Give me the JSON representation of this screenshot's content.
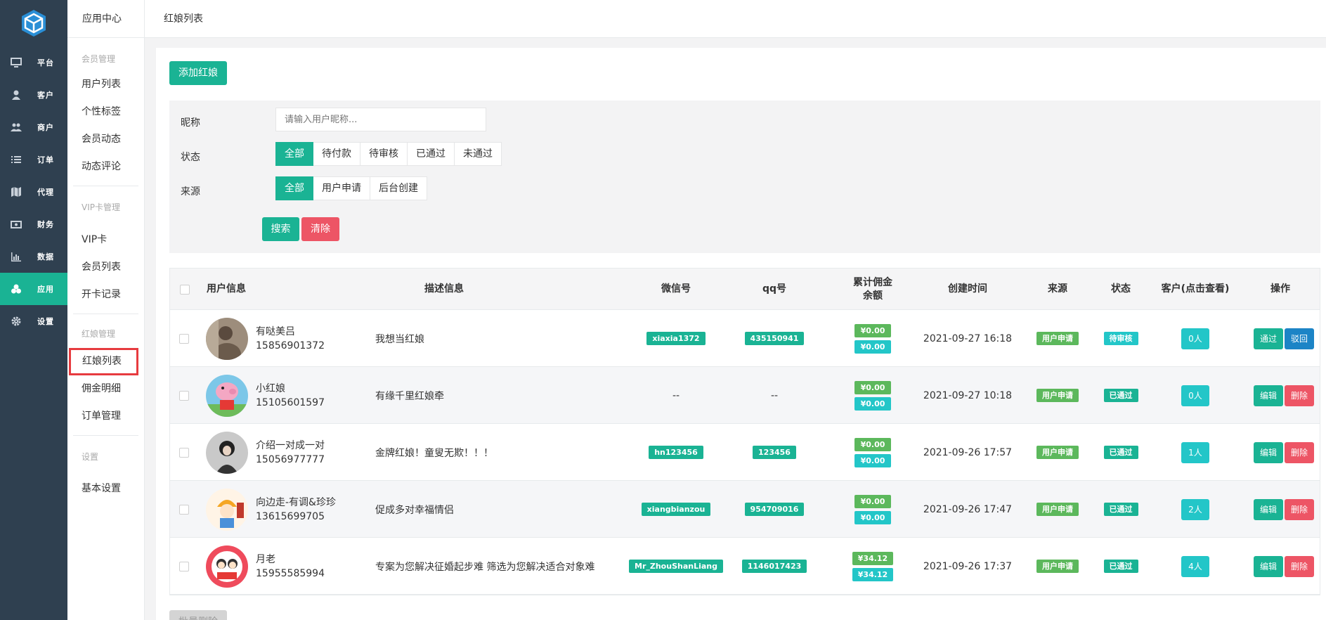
{
  "nav": {
    "items": [
      {
        "label": "平台",
        "icon": "monitor-icon"
      },
      {
        "label": "客户",
        "icon": "user-icon"
      },
      {
        "label": "商户",
        "icon": "users-icon"
      },
      {
        "label": "订单",
        "icon": "list-icon"
      },
      {
        "label": "代理",
        "icon": "map-icon"
      },
      {
        "label": "财务",
        "icon": "money-icon"
      },
      {
        "label": "数据",
        "icon": "bar-chart-icon"
      },
      {
        "label": "应用",
        "icon": "cubes-icon"
      },
      {
        "label": "设置",
        "icon": "gear-icon"
      }
    ],
    "active_color": "#1ab394"
  },
  "sidebar": {
    "title": "应用中心",
    "groups": [
      {
        "label": "会员管理",
        "items": [
          "用户列表",
          "个性标签",
          "会员动态",
          "动态评论"
        ]
      },
      {
        "label": "VIP卡管理",
        "items": [
          "VIP卡",
          "会员列表",
          "开卡记录"
        ]
      },
      {
        "label": "红娘管理",
        "items": [
          "红娘列表",
          "佣金明细",
          "订单管理"
        ]
      },
      {
        "label": "设置",
        "items": [
          "基本设置"
        ]
      }
    ]
  },
  "topbar": {
    "title": "红娘列表"
  },
  "actions": {
    "add": "添加红娘",
    "search": "搜索",
    "clear": "清除",
    "batch_delete": "批量删除"
  },
  "filter": {
    "nickname_label": "昵称",
    "nickname_placeholder": "请输入用户昵称...",
    "status_label": "状态",
    "status_options": [
      "全部",
      "待付款",
      "待审核",
      "已通过",
      "未通过"
    ],
    "source_label": "来源",
    "source_options": [
      "全部",
      "用户申请",
      "后台创建"
    ]
  },
  "table": {
    "headers": {
      "user": "用户信息",
      "desc": "描述信息",
      "wechat": "微信号",
      "qq": "qq号",
      "commission_line1": "累计佣金",
      "commission_line2": "余额",
      "created": "创建时间",
      "source": "来源",
      "status": "状态",
      "customers": "客户(点击查看)",
      "ops": "操作"
    },
    "rows": [
      {
        "name": "有哒美吕",
        "phone": "15856901372",
        "desc": "我想当红娘",
        "wechat": "xiaxia1372",
        "qq": "435150941",
        "total": "¥0.00",
        "balance": "¥0.00",
        "created": "2021-09-27 16:18",
        "source": "用户申请",
        "status": "待审核",
        "customers": "0人",
        "op1": "通过",
        "op2": "驳回"
      },
      {
        "name": "小红娘",
        "phone": "15105601597",
        "desc": "有缘千里红娘牵",
        "wechat": "--",
        "qq": "--",
        "total": "¥0.00",
        "balance": "¥0.00",
        "created": "2021-09-27 10:18",
        "source": "用户申请",
        "status": "已通过",
        "customers": "0人",
        "op1": "编辑",
        "op2": "删除"
      },
      {
        "name": "介绍一对成一对",
        "phone": "15056977777",
        "desc": "金牌红娘！童叟无欺！！！",
        "wechat": "hn123456",
        "qq": "123456",
        "total": "¥0.00",
        "balance": "¥0.00",
        "created": "2021-09-26 17:57",
        "source": "用户申请",
        "status": "已通过",
        "customers": "1人",
        "op1": "编辑",
        "op2": "删除"
      },
      {
        "name": "向边走-有调&珍珍",
        "phone": "13615699705",
        "desc": "促成多对幸福情侣",
        "wechat": "xiangbianzou",
        "qq": "954709016",
        "total": "¥0.00",
        "balance": "¥0.00",
        "created": "2021-09-26 17:47",
        "source": "用户申请",
        "status": "已通过",
        "customers": "2人",
        "op1": "编辑",
        "op2": "删除"
      },
      {
        "name": "月老",
        "phone": "15955585994",
        "desc": "专案为您解决征婚起步难 筛选为您解决适合对象难",
        "wechat": "Mr_ZhouShanLiang",
        "qq": "1146017423",
        "total": "¥34.12",
        "balance": "¥34.12",
        "created": "2021-09-26 17:37",
        "source": "用户申请",
        "status": "已通过",
        "customers": "4人",
        "op1": "编辑",
        "op2": "删除"
      }
    ]
  }
}
